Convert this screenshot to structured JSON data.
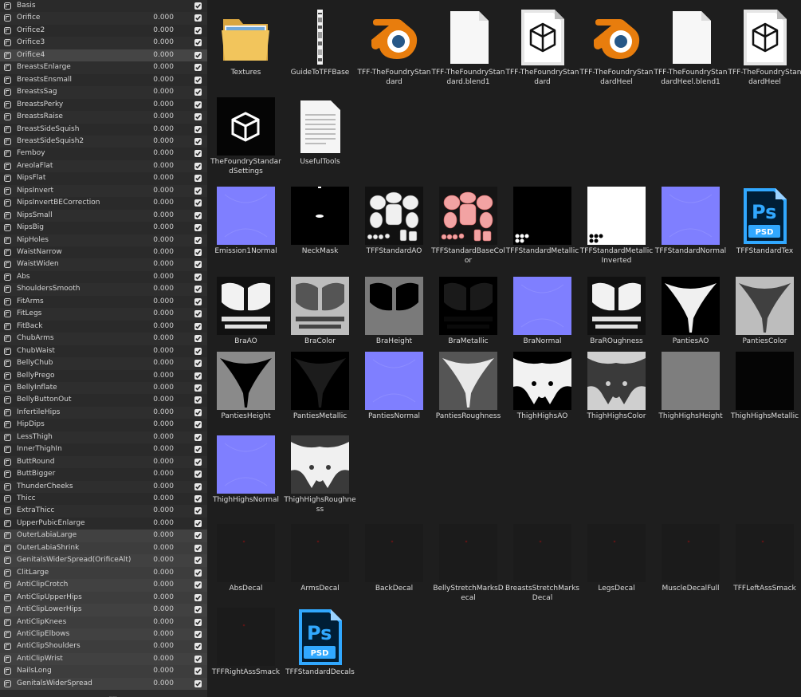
{
  "shape_keys": [
    {
      "name": "Basis",
      "value": "",
      "checked": true
    },
    {
      "name": "Orifice",
      "value": "0.000",
      "checked": true
    },
    {
      "name": "Orifice2",
      "value": "0.000",
      "checked": true
    },
    {
      "name": "Orifice3",
      "value": "0.000",
      "checked": true
    },
    {
      "name": "Orifice4",
      "value": "0.000",
      "checked": true,
      "active": true
    },
    {
      "name": "BreastsEnlarge",
      "value": "0.000",
      "checked": true
    },
    {
      "name": "BreastsEnsmall",
      "value": "0.000",
      "checked": true
    },
    {
      "name": "BreastsSag",
      "value": "0.000",
      "checked": true
    },
    {
      "name": "BreastsPerky",
      "value": "0.000",
      "checked": true
    },
    {
      "name": "BreastsRaise",
      "value": "0.000",
      "checked": true
    },
    {
      "name": "BreastSideSquish",
      "value": "0.000",
      "checked": true
    },
    {
      "name": "BreastSideSquish2",
      "value": "0.000",
      "checked": true
    },
    {
      "name": "Femboy",
      "value": "0.000",
      "checked": true
    },
    {
      "name": "AreolaFlat",
      "value": "0.000",
      "checked": true
    },
    {
      "name": "NipsFlat",
      "value": "0.000",
      "checked": true
    },
    {
      "name": "NipsInvert",
      "value": "0.000",
      "checked": true
    },
    {
      "name": "NipsInvertBECorrection",
      "value": "0.000",
      "checked": true
    },
    {
      "name": "NipsSmall",
      "value": "0.000",
      "checked": true
    },
    {
      "name": "NipsBig",
      "value": "0.000",
      "checked": true
    },
    {
      "name": "NipHoles",
      "value": "0.000",
      "checked": true
    },
    {
      "name": "WaistNarrow",
      "value": "0.000",
      "checked": true
    },
    {
      "name": "WaistWiden",
      "value": "0.000",
      "checked": true
    },
    {
      "name": "Abs",
      "value": "0.000",
      "checked": true
    },
    {
      "name": "ShouldersSmooth",
      "value": "0.000",
      "checked": true
    },
    {
      "name": "FitArms",
      "value": "0.000",
      "checked": true
    },
    {
      "name": "FitLegs",
      "value": "0.000",
      "checked": true
    },
    {
      "name": "FitBack",
      "value": "0.000",
      "checked": true
    },
    {
      "name": "ChubArms",
      "value": "0.000",
      "checked": true
    },
    {
      "name": "ChubWaist",
      "value": "0.000",
      "checked": true
    },
    {
      "name": "BellyChub",
      "value": "0.000",
      "checked": true
    },
    {
      "name": "BellyPrego",
      "value": "0.000",
      "checked": true
    },
    {
      "name": "BellyInflate",
      "value": "0.000",
      "checked": true
    },
    {
      "name": "BellyButtonOut",
      "value": "0.000",
      "checked": true
    },
    {
      "name": "InfertileHips",
      "value": "0.000",
      "checked": true
    },
    {
      "name": "HipDips",
      "value": "0.000",
      "checked": true
    },
    {
      "name": "LessThigh",
      "value": "0.000",
      "checked": true
    },
    {
      "name": "InnerThighIn",
      "value": "0.000",
      "checked": true
    },
    {
      "name": "ButtRound",
      "value": "0.000",
      "checked": true
    },
    {
      "name": "ButtBigger",
      "value": "0.000",
      "checked": true
    },
    {
      "name": "ThunderCheeks",
      "value": "0.000",
      "checked": true
    },
    {
      "name": "Thicc",
      "value": "0.000",
      "checked": true
    },
    {
      "name": "ExtraThicc",
      "value": "0.000",
      "checked": true
    },
    {
      "name": "UpperPubicEnlarge",
      "value": "0.000",
      "checked": true
    },
    {
      "name": "OuterLabiaLarge",
      "value": "0.000",
      "checked": true,
      "grey": true
    },
    {
      "name": "OuterLabiaShrink",
      "value": "0.000",
      "checked": true,
      "grey": true
    },
    {
      "name": "GenitalsWiderSpread(OrificeAlt)",
      "value": "0.000",
      "checked": true,
      "grey": true
    },
    {
      "name": "ClitLarge",
      "value": "0.000",
      "checked": true,
      "grey": true
    },
    {
      "name": "AntiClipCrotch",
      "value": "0.000",
      "checked": true,
      "grey": true
    },
    {
      "name": "AntiClipUpperHips",
      "value": "0.000",
      "checked": true,
      "grey": true
    },
    {
      "name": "AntiClipLowerHips",
      "value": "0.000",
      "checked": true,
      "grey": true
    },
    {
      "name": "AntiClipKnees",
      "value": "0.000",
      "checked": true,
      "grey": true
    },
    {
      "name": "AntiClipElbows",
      "value": "0.000",
      "checked": true,
      "grey": true
    },
    {
      "name": "AntiClipShoulders",
      "value": "0.000",
      "checked": true,
      "grey": true
    },
    {
      "name": "AntiClipWrist",
      "value": "0.000",
      "checked": true,
      "grey": true
    },
    {
      "name": "NailsLong",
      "value": "0.000",
      "checked": true,
      "grey": true
    },
    {
      "name": "GenitalsWiderSpread",
      "value": "0.000",
      "checked": true,
      "grey": true
    }
  ],
  "files": [
    {
      "label": "Textures",
      "kind": "folder-icon"
    },
    {
      "label": "GuideToTFFBase",
      "kind": "guide"
    },
    {
      "label": "TFF-TheFoundryStandard",
      "kind": "blender-icon"
    },
    {
      "label": "TFF-TheFoundryStandard.blend1",
      "kind": "blank-file-icon"
    },
    {
      "label": "TFF-TheFoundryStandard",
      "kind": "unity-file-icon"
    },
    {
      "label": "TFF-TheFoundryStandardHeel",
      "kind": "blender-icon"
    },
    {
      "label": "TFF-TheFoundryStandardHeel.blend1",
      "kind": "blank-file-icon"
    },
    {
      "label": "TFF-TheFoundryStandardHeel",
      "kind": "unity-file-icon"
    },
    {
      "label": "TheFoundryStandardSettings",
      "kind": "unity-settings-icon"
    },
    {
      "label": "UsefulTools",
      "kind": "text-file-icon"
    },
    {
      "label": "Emission1Normal",
      "kind": "normal"
    },
    {
      "label": "NeckMask",
      "kind": "neckmask"
    },
    {
      "label": "TFFStandardAO",
      "kind": "bodyao"
    },
    {
      "label": "TFFStandardBaseColor",
      "kind": "bodycolor"
    },
    {
      "label": "TFFStandardMetallic",
      "kind": "bodymetal"
    },
    {
      "label": "TFFStandardMetallicInverted",
      "kind": "bodymetalinv"
    },
    {
      "label": "TFFStandardNormal",
      "kind": "normal"
    },
    {
      "label": "TFFStandardTex",
      "kind": "psd-icon"
    },
    {
      "label": "BraAO",
      "kind": "braao"
    },
    {
      "label": "BraColor",
      "kind": "bracolor"
    },
    {
      "label": "BraHeight",
      "kind": "braheight"
    },
    {
      "label": "BraMetallic",
      "kind": "brametal"
    },
    {
      "label": "BraNormal",
      "kind": "normal"
    },
    {
      "label": "BraROughness",
      "kind": "braao"
    },
    {
      "label": "PantiesAO",
      "kind": "pantiesao"
    },
    {
      "label": "PantiesColor",
      "kind": "pantiescolor"
    },
    {
      "label": "PantiesHeight",
      "kind": "pantiesheight"
    },
    {
      "label": "PantiesMetallic",
      "kind": "pantiesmetal"
    },
    {
      "label": "PantiesNormal",
      "kind": "normal"
    },
    {
      "label": "PantiesRoughness",
      "kind": "pantiesrough"
    },
    {
      "label": "ThighHighsAO",
      "kind": "thighao"
    },
    {
      "label": "ThighHighsColor",
      "kind": "thighcolor"
    },
    {
      "label": "ThighHighsHeight",
      "kind": "flatgrey"
    },
    {
      "label": "ThighHighsMetallic",
      "kind": "flatblack"
    },
    {
      "label": "ThighHighsNormal",
      "kind": "normal"
    },
    {
      "label": "ThighHighsRoughness",
      "kind": "thighrough"
    },
    {
      "label": "AbsDecal",
      "kind": "decal"
    },
    {
      "label": "ArmsDecal",
      "kind": "decal"
    },
    {
      "label": "BackDecal",
      "kind": "decal"
    },
    {
      "label": "BellyStretchMarksDecal",
      "kind": "decal"
    },
    {
      "label": "BreastsStretchMarksDecal",
      "kind": "decal"
    },
    {
      "label": "LegsDecal",
      "kind": "decal"
    },
    {
      "label": "MuscleDecalFull",
      "kind": "decal"
    },
    {
      "label": "TFFLeftAssSmack",
      "kind": "decal"
    },
    {
      "label": "TFFRightAssSmack",
      "kind": "decal"
    },
    {
      "label": "TFFStandardDecals",
      "kind": "psd-icon"
    }
  ],
  "psd_text": "Ps",
  "psd_badge": "PSD",
  "colors": {
    "normal_map": "#7f7fff",
    "accent_blender": "#e87d0d",
    "psd_blue": "#31a8ff",
    "psd_dark": "#001e36"
  }
}
